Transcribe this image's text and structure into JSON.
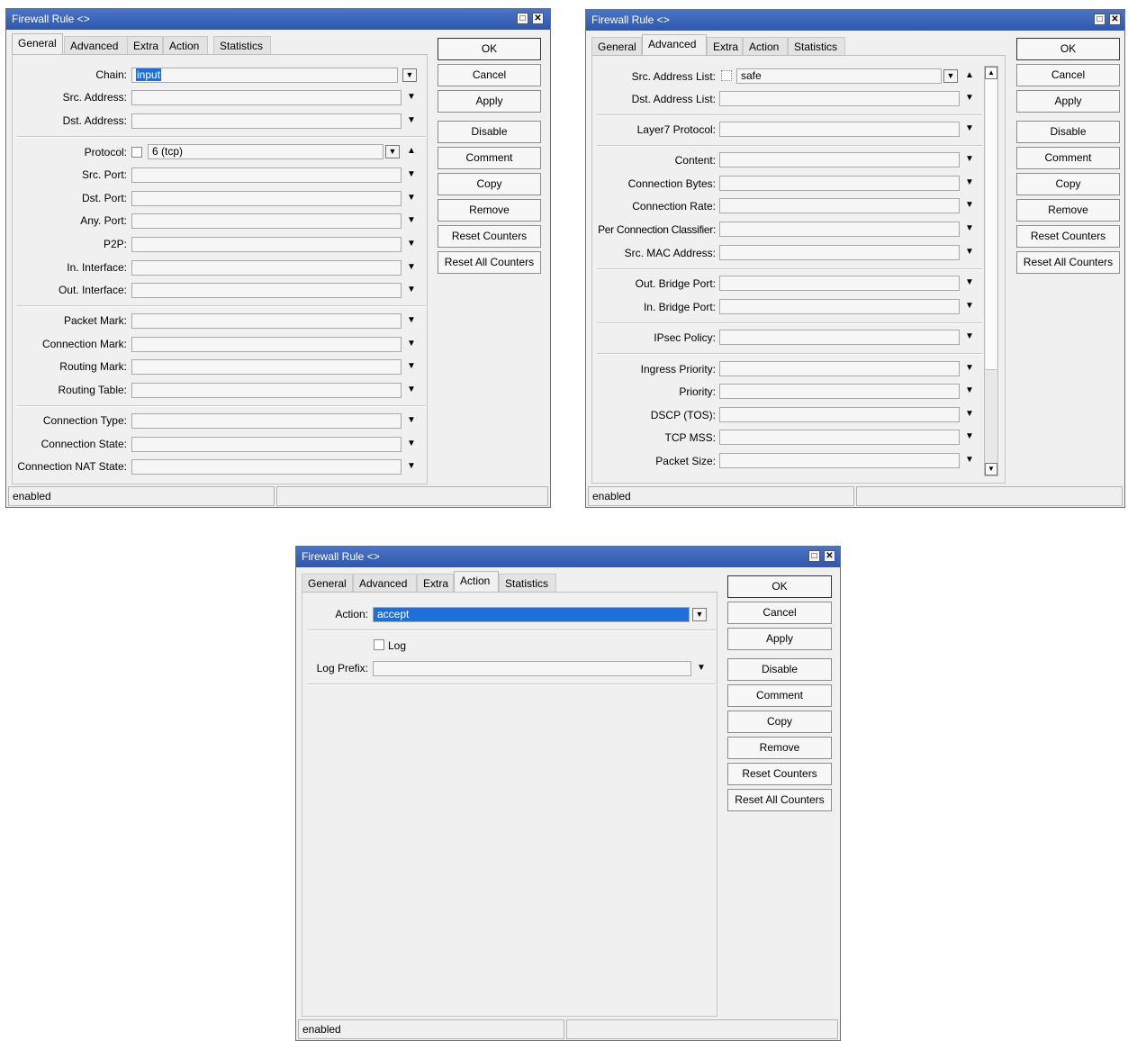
{
  "title": "Firewall Rule <>",
  "title_buttons": {
    "restore": "□",
    "close": "✕"
  },
  "tabs": [
    "General",
    "Advanced",
    "Extra",
    "Action",
    "Statistics"
  ],
  "buttons": [
    "OK",
    "Cancel",
    "Apply",
    "Disable",
    "Comment",
    "Copy",
    "Remove",
    "Reset Counters",
    "Reset All Counters"
  ],
  "status": "enabled",
  "general": {
    "active_tab": "General",
    "chain_label": "Chain:",
    "chain_value": "input",
    "src_address_label": "Src. Address:",
    "dst_address_label": "Dst. Address:",
    "protocol_label": "Protocol:",
    "protocol_value": "6 (tcp)",
    "src_port_label": "Src. Port:",
    "dst_port_label": "Dst. Port:",
    "any_port_label": "Any. Port:",
    "p2p_label": "P2P:",
    "in_interface_label": "In. Interface:",
    "out_interface_label": "Out. Interface:",
    "packet_mark_label": "Packet Mark:",
    "connection_mark_label": "Connection Mark:",
    "routing_mark_label": "Routing Mark:",
    "routing_table_label": "Routing Table:",
    "connection_type_label": "Connection Type:",
    "connection_state_label": "Connection State:",
    "connection_nat_state_label": "Connection NAT State:"
  },
  "advanced": {
    "active_tab": "Advanced",
    "src_address_list_label": "Src. Address List:",
    "src_address_list_value": "safe",
    "dst_address_list_label": "Dst. Address List:",
    "layer7_label": "Layer7 Protocol:",
    "content_label": "Content:",
    "connection_bytes_label": "Connection Bytes:",
    "connection_rate_label": "Connection Rate:",
    "per_connection_classifier_label": "Per Connection Classifier:",
    "src_mac_label": "Src. MAC Address:",
    "out_bridge_port_label": "Out. Bridge Port:",
    "in_bridge_port_label": "In. Bridge Port:",
    "ipsec_policy_label": "IPsec Policy:",
    "ingress_priority_label": "Ingress Priority:",
    "priority_label": "Priority:",
    "dscp_label": "DSCP (TOS):",
    "tcp_mss_label": "TCP MSS:",
    "packet_size_label": "Packet Size:"
  },
  "action": {
    "active_tab": "Action",
    "action_label": "Action:",
    "action_value": "accept",
    "log_label": "Log",
    "log_prefix_label": "Log Prefix:"
  },
  "icons": {
    "dropdown": "chevron-down-icon",
    "dropdown_box": "dropdown-box-icon",
    "collapse": "chevron-up-icon"
  }
}
